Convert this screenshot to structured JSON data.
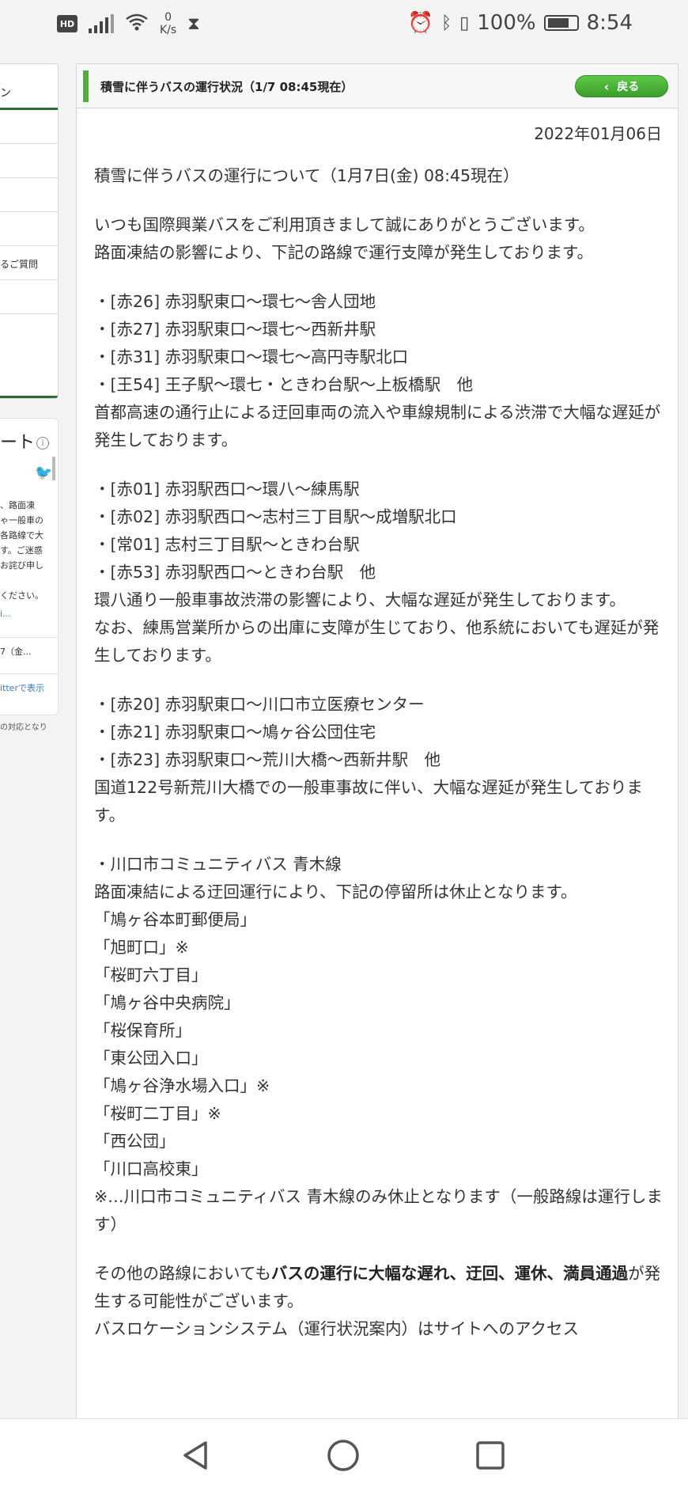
{
  "status_bar": {
    "hd": "HD",
    "speed_value": "0",
    "speed_unit": "K/s",
    "battery": "100%",
    "time": "8:54"
  },
  "left_column": {
    "nav_header": "ン",
    "nav_items": [
      "",
      "",
      "",
      "",
      "るご質問",
      "",
      ""
    ],
    "tweet_title": "ート",
    "tweet_text": "、路面凍\nゃ一般車の\n各路線で大\nす。ご迷惑\nお詫び申し\n\nください。",
    "tweet_link": "i...",
    "tweet_date": "7（金...",
    "twitter_link": "itterで表示",
    "footer": "の対応となり"
  },
  "header": {
    "title": "積雪に伴うバスの運行状況（1/7 08:45現在）",
    "back_label": "戻る"
  },
  "article": {
    "date": "2022年01月06日",
    "heading": "積雪に伴うバスの運行について（1月7日(金) 08:45現在）",
    "intro_1": "いつも国際興業バスをご利用頂きまして誠にありがとうございます。",
    "intro_2": "路面凍結の影響により、下記の路線で運行支障が発生しております。",
    "group1": [
      "・[赤26] 赤羽駅東口〜環七〜舎人団地",
      "・[赤27] 赤羽駅東口〜環七〜西新井駅",
      "・[赤31] 赤羽駅東口〜環七〜高円寺駅北口",
      "・[王54] 王子駅〜環七・ときわ台駅〜上板橋駅　他"
    ],
    "group1_note": "首都高速の通行止による迂回車両の流入や車線規制による渋滞で大幅な遅延が発生しております。",
    "group2": [
      "・[赤01] 赤羽駅西口〜環八〜練馬駅",
      "・[赤02] 赤羽駅西口〜志村三丁目駅〜成増駅北口",
      "・[常01] 志村三丁目駅〜ときわ台駅",
      "・[赤53] 赤羽駅西口〜ときわ台駅　他"
    ],
    "group2_note_1": "環八通り一般車事故渋滞の影響により、大幅な遅延が発生しております。",
    "group2_note_2": "なお、練馬営業所からの出庫に支障が生じており、他系統においても遅延が発生しております。",
    "group3": [
      "・[赤20] 赤羽駅東口〜川口市立医療センター",
      "・[赤21] 赤羽駅東口〜鳩ヶ谷公団住宅",
      "・[赤23] 赤羽駅東口〜荒川大橋〜西新井駅　他"
    ],
    "group3_note": "国道122号新荒川大橋での一般車事故に伴い、大幅な遅延が発生しております。",
    "group4_title": "・川口市コミュニティバス 青木線",
    "group4_note": "路面凍結による迂回運行により、下記の停留所は休止となります。",
    "stops": [
      "「鳩ヶ谷本町郵便局」",
      "「旭町口」※",
      "「桜町六丁目」",
      "「鳩ヶ谷中央病院」",
      "「桜保育所」",
      "「東公団入口」",
      "「鳩ヶ谷浄水場入口」※",
      "「桜町二丁目」※",
      "「西公団」",
      "「川口高校東」"
    ],
    "stops_footnote": "※…川口市コミュニティバス 青木線のみ休止となります（一般路線は運行します）",
    "closing_pre": "その他の路線においても",
    "closing_bold": "バスの運行に大幅な遅れ、迂回、運休、満員通過",
    "closing_post": "が発生する可能性がございます。",
    "closing_2": "バスロケーションシステム（運行状況案内）はサイトへのアクセス"
  }
}
